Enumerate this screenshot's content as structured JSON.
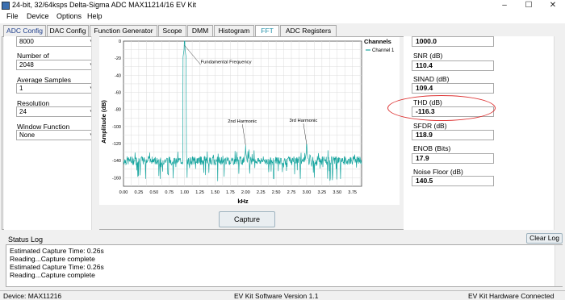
{
  "window": {
    "title": "24-bit, 32/64ksps Delta-Sigma ADC MAX11214/16 EV Kit",
    "minimize": "–",
    "maximize": "☐",
    "close": "✕"
  },
  "menu": [
    "File",
    "Device",
    "Options",
    "Help"
  ],
  "tabs": [
    "ADC Config",
    "DAC Config",
    "Function Generator",
    "Scope",
    "DMM",
    "Histogram",
    "FFT",
    "ADC Registers"
  ],
  "active_tab": "FFT",
  "left": {
    "top_combo": "8000",
    "number_of_label": "Number of",
    "number_of_value": "2048",
    "average_label": "Average Samples",
    "average_value": "1",
    "resolution_label": "Resolution",
    "resolution_value": "24",
    "window_label": "Window Function",
    "window_value": "None"
  },
  "right": {
    "top_value": "1000.0",
    "snr_label": "SNR (dB)",
    "snr_value": "110.4",
    "sinad_label": "SINAD (dB)",
    "sinad_value": "109.4",
    "thd_label": "THD (dB)",
    "thd_value": "-116.3",
    "sfdr_label": "SFDR (dB)",
    "sfdr_value": "118.9",
    "enob_label": "ENOB (Bits)",
    "enob_value": "17.9",
    "noise_label": "Noise Floor (dB)",
    "noise_value": "140.5"
  },
  "capture_label": "Capture",
  "status_log": {
    "title": "Status Log",
    "clear_label": "Clear Log",
    "lines": [
      "Estimated Capture Time: 0.26s",
      "Reading...Capture complete",
      "Estimated Capture Time: 0.26s",
      "Reading...Capture complete"
    ]
  },
  "statusbar": {
    "device": "Device: MAX11216",
    "version": "EV Kit Software Version 1.1",
    "hardware": "EV Kit Hardware Connected"
  },
  "colors": {
    "trace": "#1aa6a0",
    "accent_tab": "#1b8ca6",
    "highlight": "#d33333"
  },
  "chart_data": {
    "type": "line",
    "xlabel": "kHz",
    "ylabel": "Amplitude (dB)",
    "legend_title": "Channels",
    "series": [
      {
        "name": "Channel 1"
      }
    ],
    "xlim": [
      0,
      3.9
    ],
    "ylim": [
      -170,
      0
    ],
    "xticks": [
      "0.00",
      "0.25",
      "0.50",
      "0.75",
      "1.00",
      "1.25",
      "1.50",
      "1.75",
      "2.00",
      "2.25",
      "2.50",
      "2.75",
      "3.00",
      "3.25",
      "3.50",
      "3.75"
    ],
    "yticks": [
      "0",
      "-20",
      "-40",
      "-60",
      "-80",
      "-100",
      "-120",
      "-140",
      "-160"
    ],
    "noise_floor_db": -140,
    "peaks": [
      {
        "x": 1.0,
        "y": 0
      },
      {
        "x": 2.0,
        "y": -122
      },
      {
        "x": 3.0,
        "y": -121
      }
    ],
    "annotations": [
      {
        "text": "Fundamental Frequency",
        "x": 1.0,
        "y": -5
      },
      {
        "text": "2nd Harmonic",
        "x": 2.0,
        "y": -122
      },
      {
        "text": "3rd Harmonic",
        "x": 3.0,
        "y": -121
      }
    ]
  }
}
